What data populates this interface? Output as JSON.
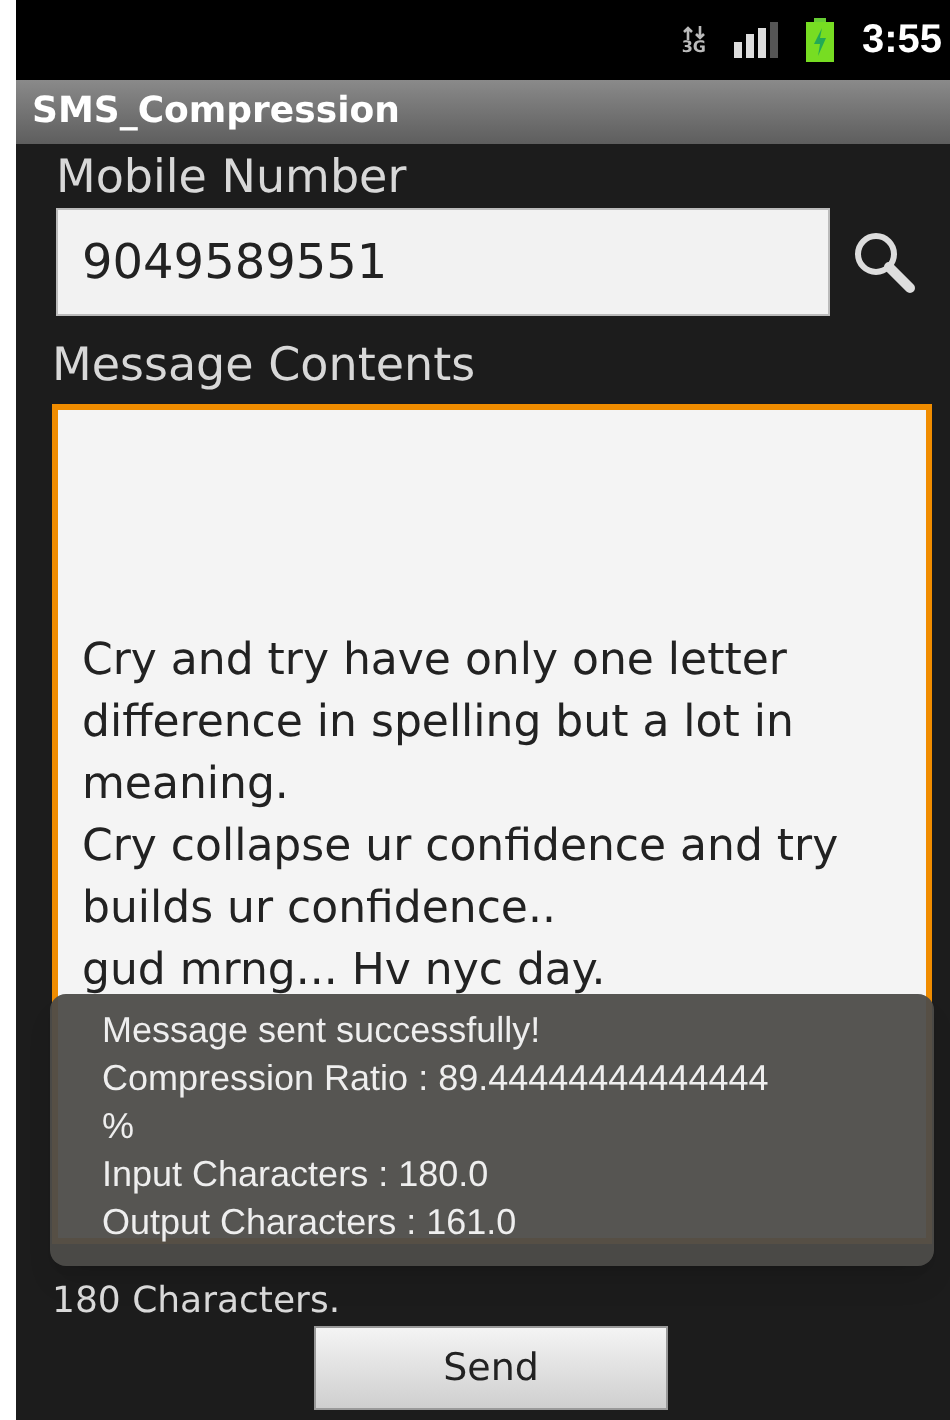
{
  "status_bar": {
    "network_type": "3G",
    "time": "3:55"
  },
  "title_bar": {
    "title": "SMS_Compression"
  },
  "mobile_number": {
    "label": "Mobile Number",
    "value": "9049589551"
  },
  "message": {
    "label": "Message Contents",
    "value": "Cry and try have only one letter difference in spelling but a lot in meaning.\nCry collapse ur confidence and try builds ur confidence..\ngud mrng... Hv nyc day.",
    "focused": true
  },
  "toast": {
    "lines": [
      "Message sent successfully!",
      "Compression Ratio : 89.44444444444444",
      "%",
      "Input Characters : 180.0",
      "Output Characters : 161.0"
    ]
  },
  "char_count": "180 Characters.",
  "buttons": [
    {
      "label": "Send"
    }
  ]
}
